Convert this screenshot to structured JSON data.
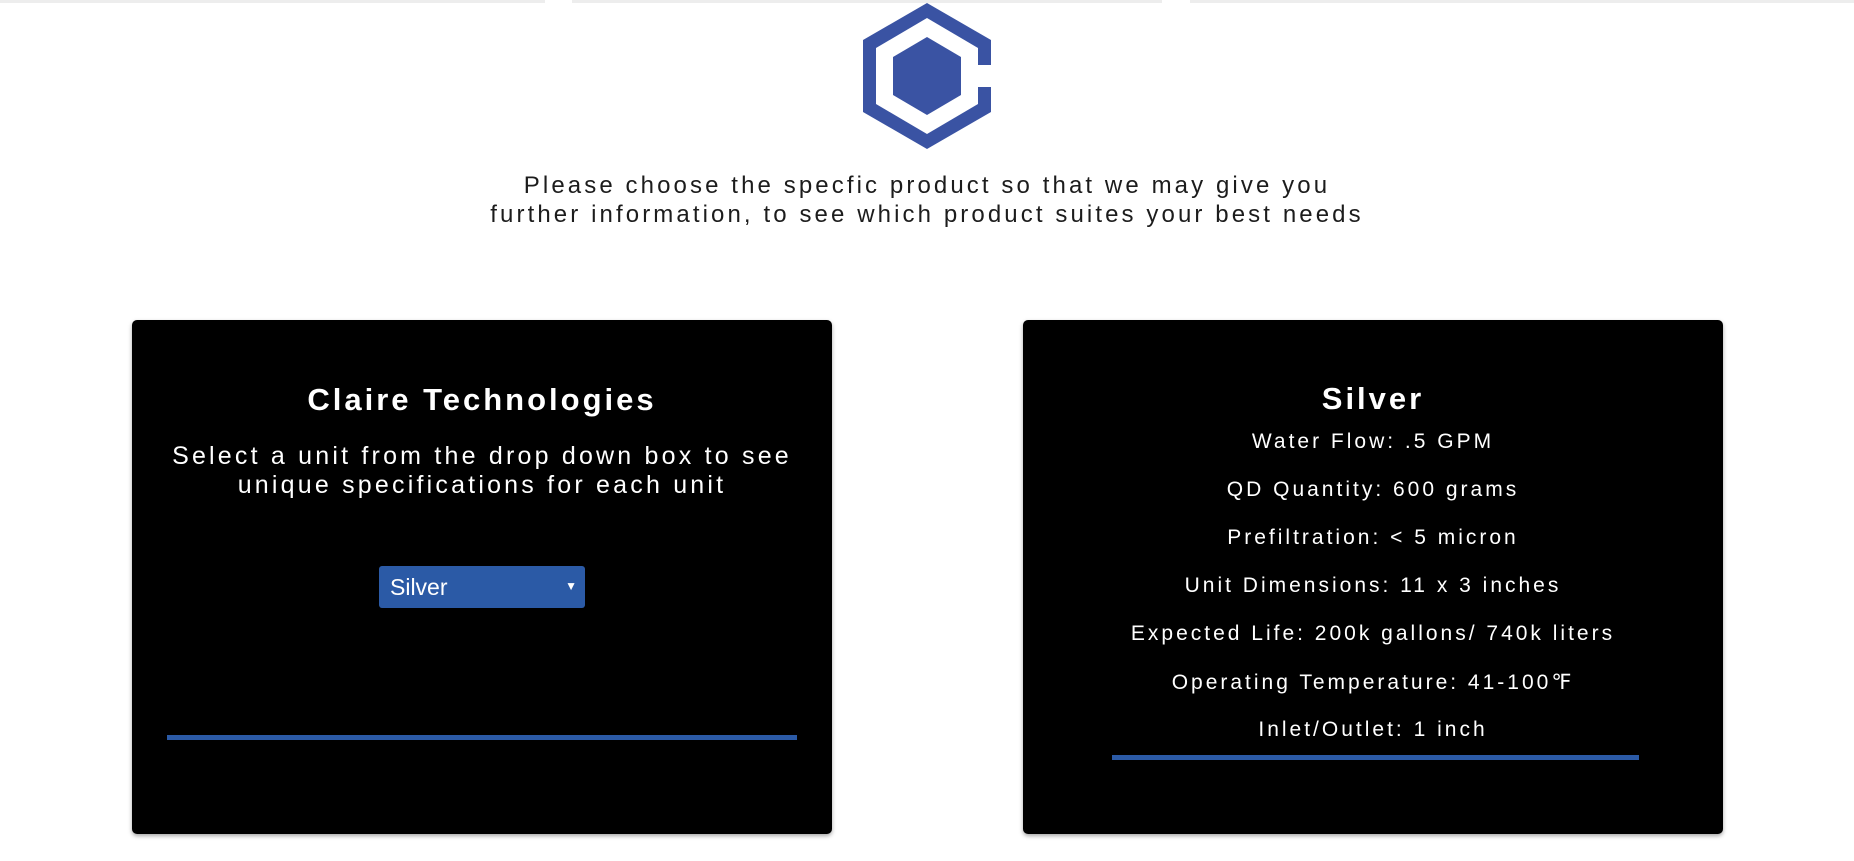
{
  "intro": {
    "text": "Please choose the specfic product so that we may give you further information, to see which product suites your best needs"
  },
  "selector_card": {
    "title": "Claire Technologies",
    "description": "Select a unit from the drop down box to see unique specifications for each unit",
    "select": {
      "selected": "Silver",
      "arrow_icon": "triangle-down"
    }
  },
  "spec_card": {
    "title": "Silver",
    "specs": [
      "Water Flow: .5 GPM",
      "QD Quantity: 600 grams",
      "Prefiltration: < 5 micron",
      "Unit Dimensions: 11 x 3 inches",
      "Expected Life: 200k gallons/ 740k liters",
      "Operating Temperature: 41-100℉",
      "Inlet/Outlet: 1 inch"
    ]
  },
  "colors": {
    "brand_blue": "#3a53a3",
    "accent_blue": "#2b5aa6",
    "card_background": "#000000"
  }
}
